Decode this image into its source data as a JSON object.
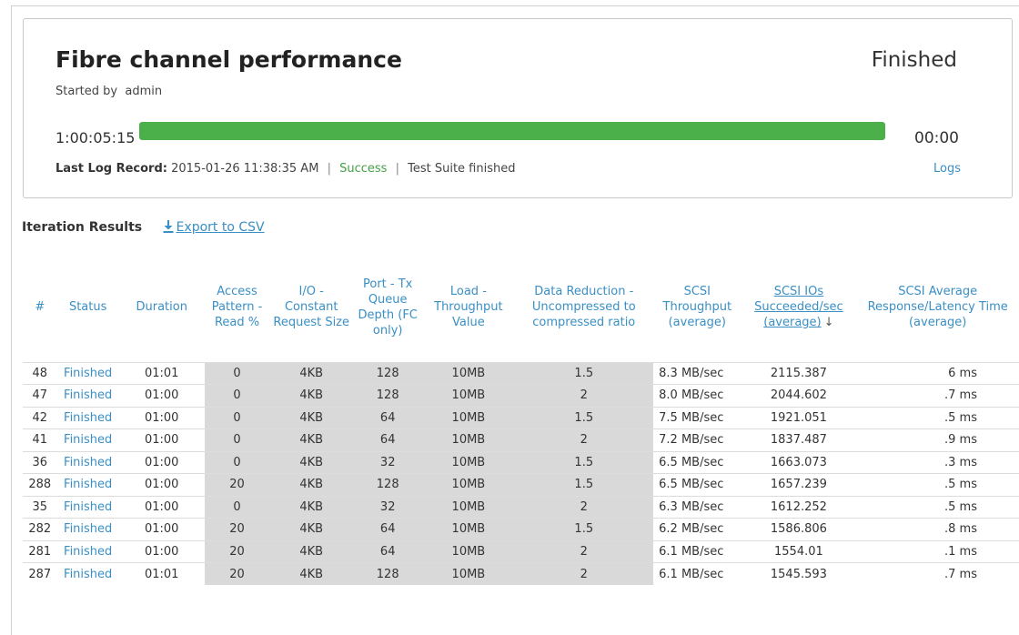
{
  "test": {
    "title": "Fibre channel performance",
    "started_by_label": "Started by",
    "started_by_user": "admin",
    "status": "Finished",
    "elapsed": "1:00:05:15",
    "remaining": "00:00",
    "progress_percent": 100,
    "log_label": "Last Log Record:",
    "log_timestamp": "2015-01-26 11:38:35 AM",
    "log_result": "Success",
    "log_message": "Test Suite finished",
    "logs_link": "Logs",
    "progress_color": "#4cb04a"
  },
  "results": {
    "title": "Iteration Results",
    "export_label": "Export to CSV",
    "columns": [
      "#",
      "Status",
      "Duration",
      "Access Pattern - Read %",
      "I/O - Constant Request Size",
      "Port - Tx Queue Depth (FC only)",
      "Load - Throughput Value",
      "Data Reduction - Uncompressed to compressed ratio",
      "SCSI Throughput (average)",
      "SCSI IOs Succeeded/sec (average)",
      "SCSI Average Response/Latency Time (average)"
    ],
    "rows": [
      [
        "48",
        "Finished",
        "01:01",
        "0",
        "4KB",
        "128",
        "10MB",
        "1.5",
        "8.3 MB/sec",
        "2115.387",
        "6 ms"
      ],
      [
        "47",
        "Finished",
        "01:00",
        "0",
        "4KB",
        "128",
        "10MB",
        "2",
        "8.0 MB/sec",
        "2044.602",
        ".7 ms"
      ],
      [
        "42",
        "Finished",
        "01:00",
        "0",
        "4KB",
        "64",
        "10MB",
        "1.5",
        "7.5 MB/sec",
        "1921.051",
        ".5 ms"
      ],
      [
        "41",
        "Finished",
        "01:00",
        "0",
        "4KB",
        "64",
        "10MB",
        "2",
        "7.2 MB/sec",
        "1837.487",
        ".9 ms"
      ],
      [
        "36",
        "Finished",
        "01:00",
        "0",
        "4KB",
        "32",
        "10MB",
        "1.5",
        "6.5 MB/sec",
        "1663.073",
        ".3 ms"
      ],
      [
        "288",
        "Finished",
        "01:00",
        "20",
        "4KB",
        "128",
        "10MB",
        "1.5",
        "6.5 MB/sec",
        "1657.239",
        ".5 ms"
      ],
      [
        "35",
        "Finished",
        "01:00",
        "0",
        "4KB",
        "32",
        "10MB",
        "2",
        "6.3 MB/sec",
        "1612.252",
        ".5 ms"
      ],
      [
        "282",
        "Finished",
        "01:00",
        "20",
        "4KB",
        "64",
        "10MB",
        "1.5",
        "6.2 MB/sec",
        "1586.806",
        ".8 ms"
      ],
      [
        "281",
        "Finished",
        "01:00",
        "20",
        "4KB",
        "64",
        "10MB",
        "2",
        "6.1 MB/sec",
        "1554.01",
        ".1 ms"
      ],
      [
        "287",
        "Finished",
        "01:01",
        "20",
        "4KB",
        "128",
        "10MB",
        "2",
        "6.1 MB/sec",
        "1545.593",
        ".7 ms"
      ]
    ],
    "sorted_column_index": 9,
    "sort_direction": "descending"
  },
  "icons": {
    "download": "download-icon",
    "sort": "sort-down-arrow-icon"
  },
  "colors": {
    "link": "#3a8fc4",
    "success": "#44a044",
    "shaded_cell": "#d9d9d9"
  }
}
